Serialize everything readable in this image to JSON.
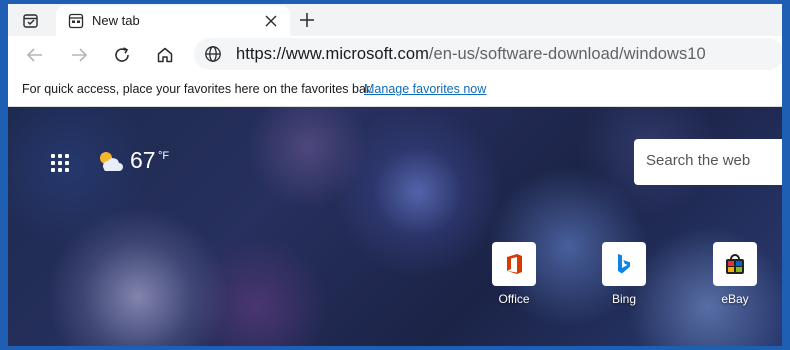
{
  "tab": {
    "title": "New tab"
  },
  "address_bar": {
    "domain": "https://www.microsoft.com",
    "path": "/en-us/software-download/windows10"
  },
  "favorites_bar": {
    "message": "For quick access, place your favorites here on the favorites bar.",
    "link": "Manage favorites now"
  },
  "weather": {
    "temperature": "67",
    "unit": "°F",
    "icon": "partly-cloudy-icon"
  },
  "search": {
    "placeholder": "Search the web"
  },
  "quick_links": [
    {
      "label": "Office",
      "icon": "office-icon"
    },
    {
      "label": "Bing",
      "icon": "bing-icon"
    },
    {
      "label": "eBay",
      "icon": "ebay-icon"
    }
  ],
  "colors": {
    "link": "#0f6cbd",
    "accent": "#1f5fb3"
  }
}
